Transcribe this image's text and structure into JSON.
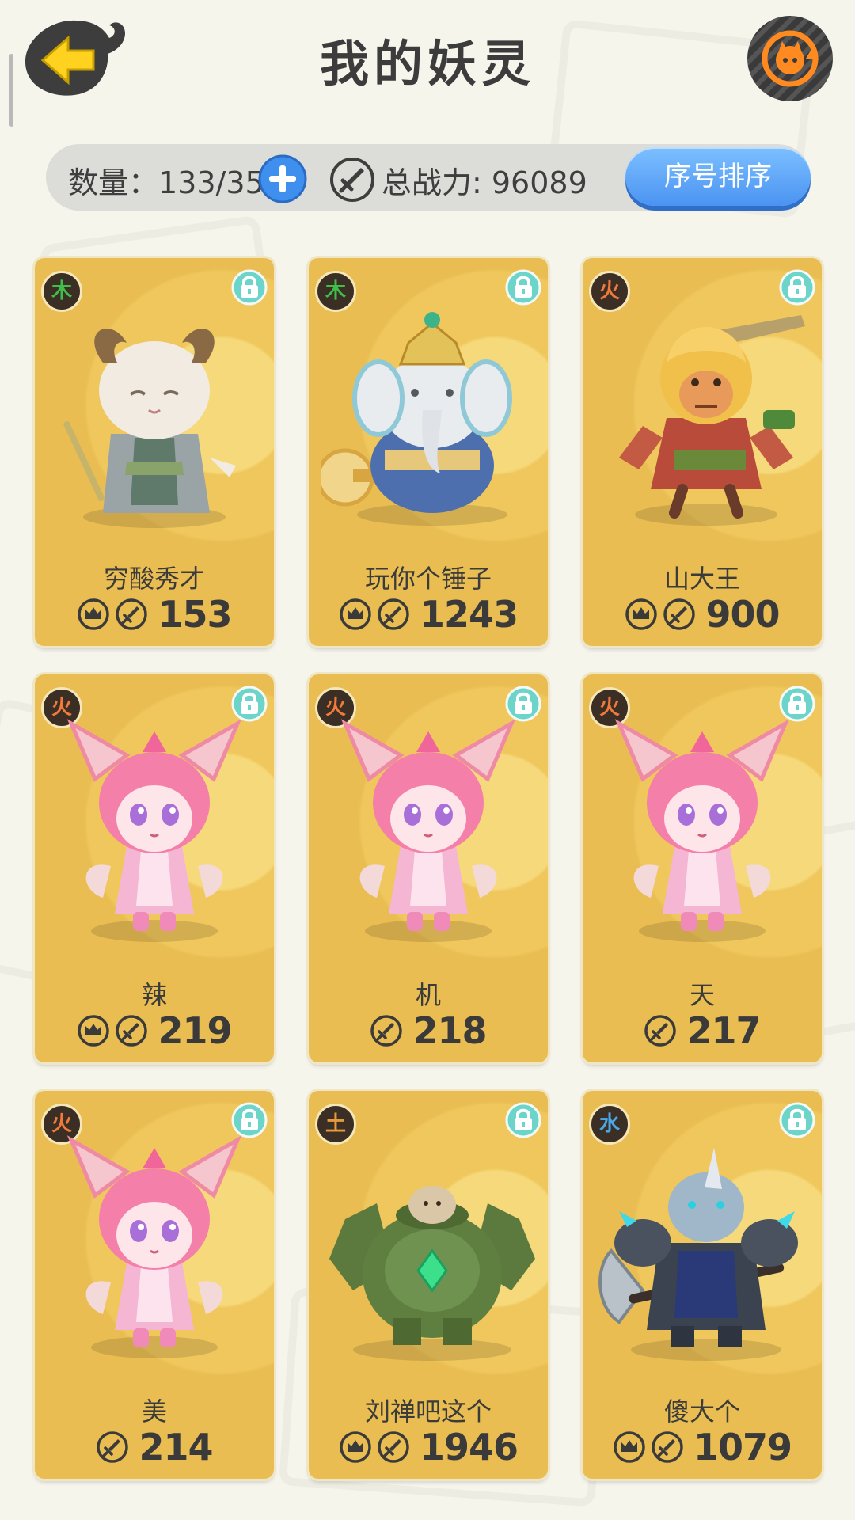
{
  "header": {
    "title": "我的妖灵"
  },
  "info_bar": {
    "count_label": "数量：133/350",
    "power_label": "总战力: 96089",
    "sort_button_label": "序号排序"
  },
  "colors": {
    "card_gold": "#e9bd52",
    "sort_button_blue": "#4b93f2",
    "element_wood": "#3fbf4a",
    "element_fire": "#f07a3a",
    "element_earth": "#e89a3a",
    "element_water": "#4aa8e8"
  },
  "cards": [
    {
      "element": "木",
      "element_color": "#3fbf4a",
      "name": "穷酸秀才",
      "power": "153",
      "has_crown": true,
      "portrait": "ram-scholar"
    },
    {
      "element": "木",
      "element_color": "#3fbf4a",
      "name": "玩你个锤子",
      "power": "1243",
      "has_crown": true,
      "portrait": "elephant-hammer"
    },
    {
      "element": "火",
      "element_color": "#f07a3a",
      "name": "山大王",
      "power": "900",
      "has_crown": true,
      "portrait": "monkey-king"
    },
    {
      "element": "火",
      "element_color": "#f07a3a",
      "name": "辣",
      "power": "219",
      "has_crown": true,
      "portrait": "pink-fox-girl"
    },
    {
      "element": "火",
      "element_color": "#f07a3a",
      "name": "机",
      "power": "218",
      "has_crown": false,
      "portrait": "pink-fox-girl"
    },
    {
      "element": "火",
      "element_color": "#f07a3a",
      "name": "天",
      "power": "217",
      "has_crown": false,
      "portrait": "pink-fox-girl"
    },
    {
      "element": "火",
      "element_color": "#f07a3a",
      "name": "美",
      "power": "214",
      "has_crown": false,
      "portrait": "pink-fox-girl"
    },
    {
      "element": "土",
      "element_color": "#e89a3a",
      "name": "刘禅吧这个",
      "power": "1946",
      "has_crown": true,
      "portrait": "stone-golem"
    },
    {
      "element": "水",
      "element_color": "#4aa8e8",
      "name": "傻大个",
      "power": "1079",
      "has_crown": true,
      "portrait": "rhino-warrior"
    }
  ]
}
